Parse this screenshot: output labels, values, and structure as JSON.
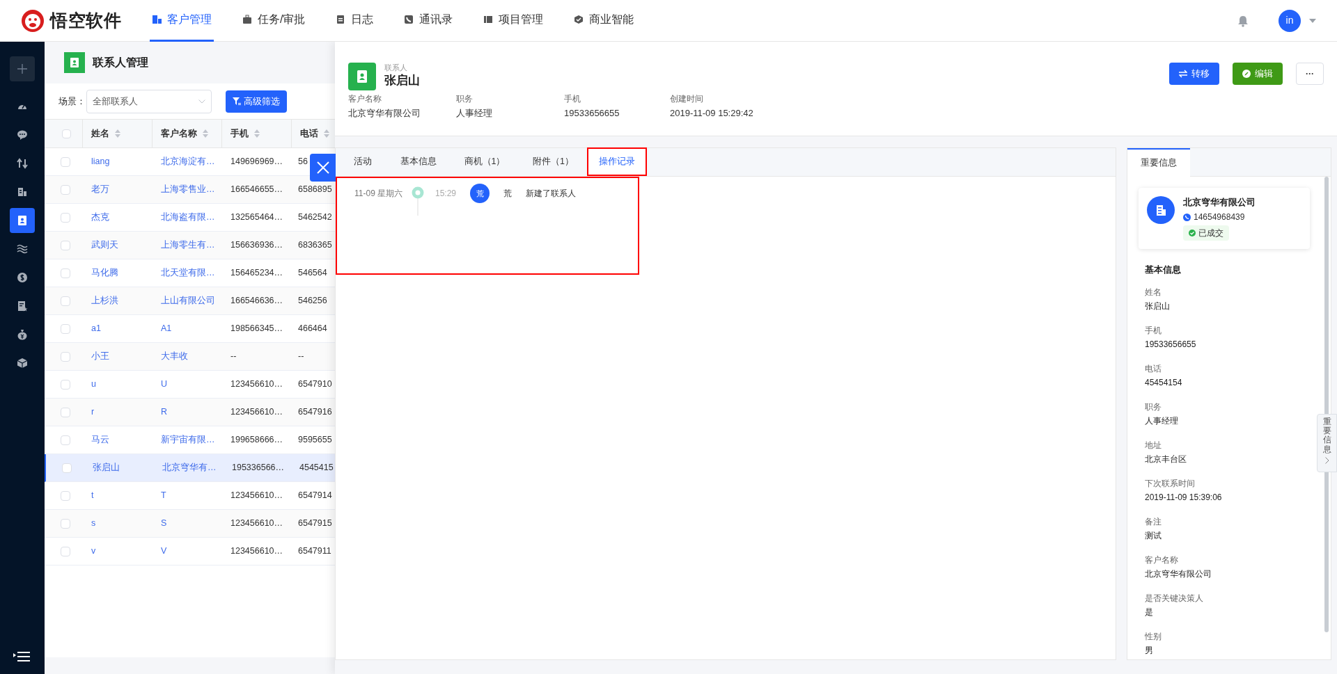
{
  "app": {
    "brand": "悟空软件"
  },
  "nav": [
    {
      "label": "客户管理",
      "selected": true
    },
    {
      "label": "任务/审批",
      "selected": false
    },
    {
      "label": "日志",
      "selected": false
    },
    {
      "label": "通讯录",
      "selected": false
    },
    {
      "label": "项目管理",
      "selected": false
    },
    {
      "label": "商业智能",
      "selected": false
    }
  ],
  "user": {
    "avatar": "in"
  },
  "sidebar": {
    "items": [
      {
        "selected": false
      },
      {
        "selected": false
      },
      {
        "selected": false
      },
      {
        "selected": false
      },
      {
        "selected": true
      },
      {
        "selected": false
      },
      {
        "selected": false
      },
      {
        "selected": false
      },
      {
        "selected": false
      },
      {
        "selected": false
      }
    ]
  },
  "list": {
    "title": "联系人管理",
    "scene_label": "场景：",
    "scene_value": "全部联系人",
    "filter_button": "高级筛选",
    "select_all_checked": false,
    "columns": [
      "姓名",
      "客户名称",
      "手机",
      "电话"
    ],
    "rows": [
      {
        "name": "liang",
        "customer": "北京海淀有…",
        "mobile": "149696969…",
        "phone": "56",
        "selected": false,
        "checked": false
      },
      {
        "name": "老万",
        "customer": "上海零售业…",
        "mobile": "166546655…",
        "phone": "6586895",
        "selected": false,
        "checked": false
      },
      {
        "name": "杰克",
        "customer": "北海盗有限…",
        "mobile": "132565464…",
        "phone": "5462542",
        "selected": false,
        "checked": false
      },
      {
        "name": "武则天",
        "customer": "上海零生有…",
        "mobile": "156636936…",
        "phone": "6836365",
        "selected": false,
        "checked": false
      },
      {
        "name": "马化腾",
        "customer": "北天堂有限…",
        "mobile": "156465234…",
        "phone": "546564",
        "selected": false,
        "checked": false
      },
      {
        "name": "上杉洪",
        "customer": "上山有限公司",
        "mobile": "166546636…",
        "phone": "546256",
        "selected": false,
        "checked": false
      },
      {
        "name": "a1",
        "customer": "A1",
        "mobile": "198566345…",
        "phone": "466464",
        "selected": false,
        "checked": false
      },
      {
        "name": "小王",
        "customer": "大丰收",
        "mobile": "--",
        "phone": "--",
        "selected": false,
        "checked": false
      },
      {
        "name": "u",
        "customer": "U",
        "mobile": "123456610…",
        "phone": "6547910",
        "selected": false,
        "checked": false
      },
      {
        "name": "r",
        "customer": "R",
        "mobile": "123456610…",
        "phone": "6547916",
        "selected": false,
        "checked": false
      },
      {
        "name": "马云",
        "customer": "新宇宙有限…",
        "mobile": "199658666…",
        "phone": "9595655",
        "selected": false,
        "checked": false
      },
      {
        "name": "张启山",
        "customer": "北京穹华有…",
        "mobile": "195336566…",
        "phone": "4545415",
        "selected": true,
        "checked": false
      },
      {
        "name": "t",
        "customer": "T",
        "mobile": "123456610…",
        "phone": "6547914",
        "selected": false,
        "checked": false
      },
      {
        "name": "s",
        "customer": "S",
        "mobile": "123456610…",
        "phone": "6547915",
        "selected": false,
        "checked": false
      },
      {
        "name": "v",
        "customer": "V",
        "mobile": "123456610…",
        "phone": "6547911",
        "selected": false,
        "checked": false
      }
    ]
  },
  "detail": {
    "type_label": "联系人",
    "name": "张启山",
    "actions": [
      {
        "kind": "transfer",
        "label": "转移"
      },
      {
        "kind": "edit",
        "label": "编辑"
      },
      {
        "kind": "more",
        "label": "···"
      }
    ],
    "summary": [
      {
        "label": "客户名称",
        "value": "北京穹华有限公司"
      },
      {
        "label": "职务",
        "value": "人事经理"
      },
      {
        "label": "手机",
        "value": "19533656655"
      },
      {
        "label": "创建时间",
        "value": "2019-11-09 15:29:42"
      }
    ],
    "tabs": [
      {
        "label": "活动",
        "selected": false,
        "highlight": false
      },
      {
        "label": "基本信息",
        "selected": false,
        "highlight": false
      },
      {
        "label": "商机（1）",
        "selected": false,
        "highlight": false
      },
      {
        "label": "附件（1）",
        "selected": false,
        "highlight": false
      },
      {
        "label": "操作记录",
        "selected": true,
        "highlight": true
      }
    ],
    "log": {
      "highlight": true,
      "entries": [
        {
          "date": "11-09 星期六",
          "time": "15:29",
          "avatar": "荒",
          "user": "荒",
          "action": "新建了联系人"
        }
      ]
    }
  },
  "side": {
    "tab": {
      "label": "重要信息",
      "selected": true
    },
    "card": {
      "company": "北京穹华有限公司",
      "phone": "14654968439",
      "status": "已成交"
    },
    "section_title": "基本信息",
    "fields": [
      {
        "label": "姓名",
        "value": "张启山"
      },
      {
        "label": "手机",
        "value": "19533656655"
      },
      {
        "label": "电话",
        "value": "45454154"
      },
      {
        "label": "职务",
        "value": "人事经理"
      },
      {
        "label": "地址",
        "value": "北京丰台区"
      },
      {
        "label": "下次联系时间",
        "value": "2019-11-09 15:39:06"
      },
      {
        "label": "备注",
        "value": "测试"
      },
      {
        "label": "客户名称",
        "value": "北京穹华有限公司"
      },
      {
        "label": "是否关键决策人",
        "value": "是"
      },
      {
        "label": "性别",
        "value": "男"
      }
    ],
    "handle": "重要信息"
  }
}
